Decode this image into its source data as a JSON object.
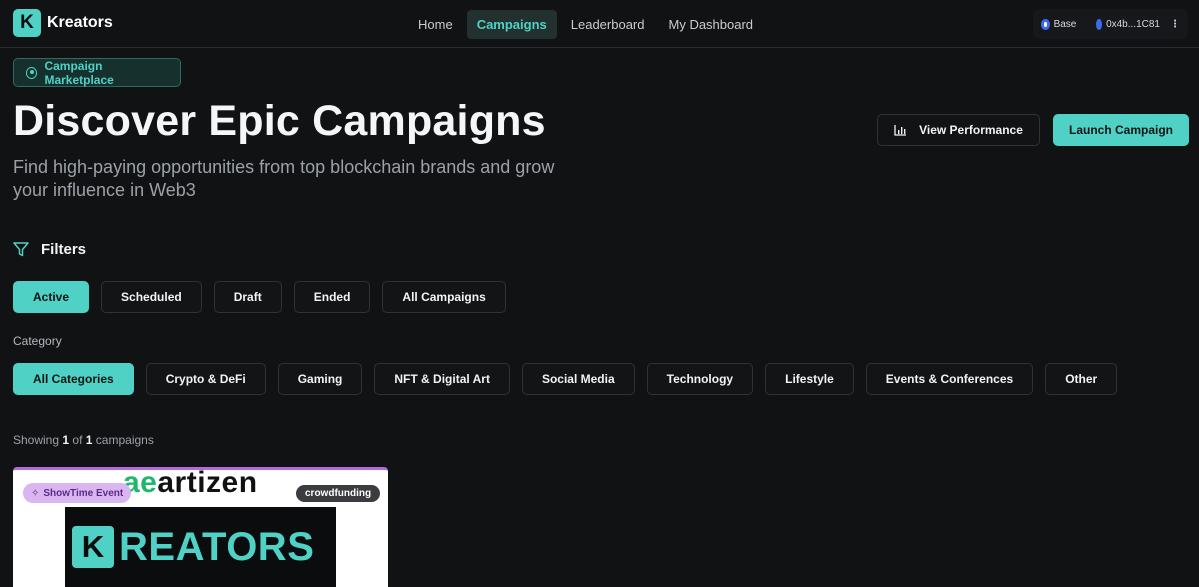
{
  "app": {
    "name": "Kreators",
    "logo_letter": "K"
  },
  "nav": {
    "items": [
      {
        "label": "Home",
        "active": false
      },
      {
        "label": "Campaigns",
        "active": true
      },
      {
        "label": "Leaderboard",
        "active": false
      },
      {
        "label": "My Dashboard",
        "active": false
      }
    ]
  },
  "wallet": {
    "network": "Base",
    "address": "0x4b...1C81"
  },
  "hero": {
    "badge": "Campaign Marketplace",
    "title": "Discover Epic Campaigns",
    "subtitle": "Find high-paying opportunities from top blockchain brands and grow your influence in Web3",
    "view_performance": "View Performance",
    "launch_campaign": "Launch Campaign"
  },
  "filters": {
    "title": "Filters",
    "status": [
      "Active",
      "Scheduled",
      "Draft",
      "Ended",
      "All Campaigns"
    ],
    "status_selected": "Active",
    "category_label": "Category",
    "categories": [
      "All Categories",
      "Crypto & DeFi",
      "Gaming",
      "NFT & Digital Art",
      "Social Media",
      "Technology",
      "Lifestyle",
      "Events & Conferences",
      "Other"
    ],
    "category_selected": "All Categories"
  },
  "results": {
    "prefix": "Showing",
    "shown": "1",
    "of": "of",
    "total": "1",
    "suffix": "campaigns"
  },
  "card": {
    "brand_mark": "ae",
    "brand_name": "artizen",
    "event_tag": "ShowTime Event",
    "category_tag": "crowdfunding",
    "banner_letter": "K",
    "banner_text": "REATORS"
  },
  "colors": {
    "accent": "#4fd1c5",
    "background": "#111214",
    "event_tag": "#d9b6f0"
  }
}
